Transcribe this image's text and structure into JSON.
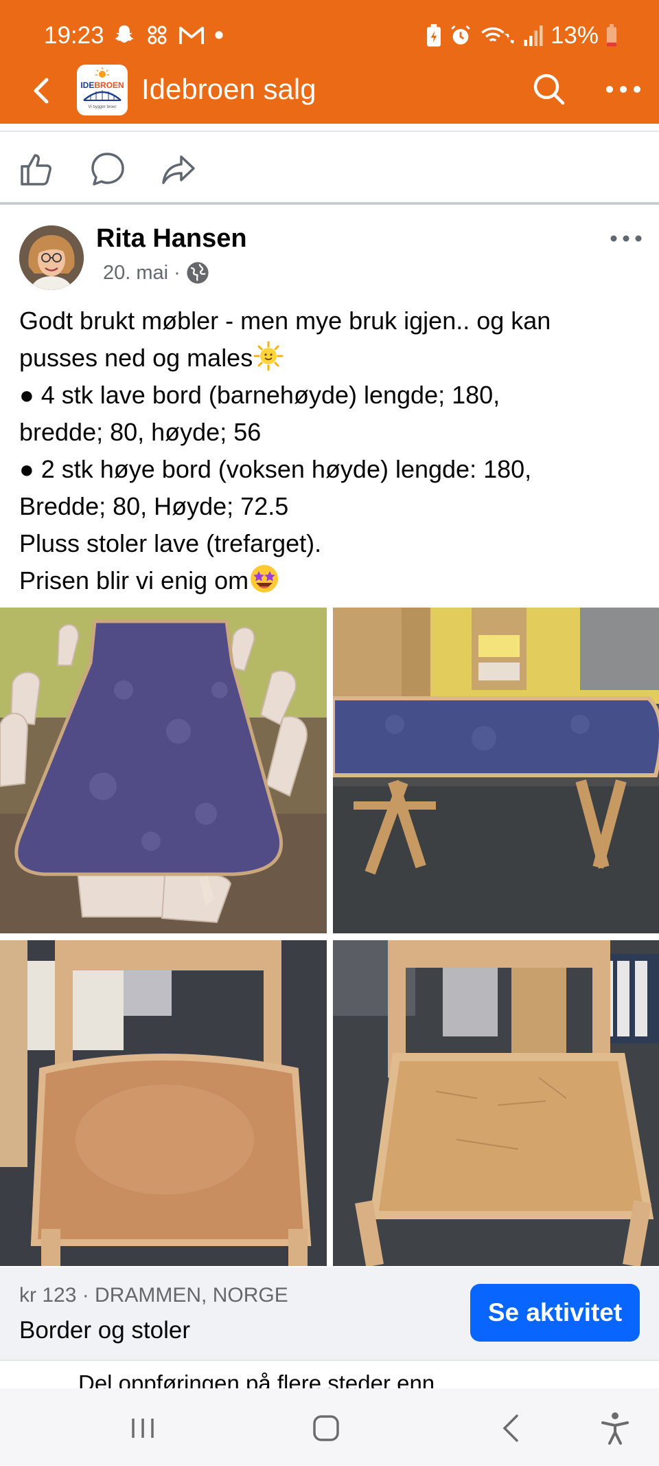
{
  "status_bar": {
    "time": "19:23",
    "battery": "13%",
    "left_icons": [
      "snapchat-icon",
      "pinwheel-icon",
      "gmail-icon",
      "dot-icon"
    ],
    "right_icons": [
      "battery-saver-icon",
      "alarm-icon",
      "wifi-call-icon",
      "signal-icon",
      "battery-icon"
    ]
  },
  "header": {
    "title": "Idebroen salg",
    "logo_text": "IDEBROEN",
    "logo_subtext": "Vi bygger broer",
    "color": "#EB6A16"
  },
  "post": {
    "author": "Rita Hansen",
    "date": "20. mai",
    "audience_icon": "globe-icon",
    "lines": [
      "Godt brukt møbler - men mye bruk igjen.. og kan",
      "pusses ned og males",
      "● 4 stk lave bord (barnehøyde) lengde; 180,",
      "bredde; 80, høyde; 56",
      "● 2 stk høye bord (voksen høyde) lengde: 180,",
      "Bredde; 80, Høyde; 72.5",
      "Pluss stoler lave (trefarget).",
      "Prisen blir vi enig om"
    ]
  },
  "listing": {
    "price_location": "kr 123 · DRAMMEN, NORGE",
    "title": "Border og stoler",
    "cta_label": "Se aktivitet",
    "cta_color": "#0866FF",
    "share_text": "Del oppføringen på flere steder enn"
  }
}
